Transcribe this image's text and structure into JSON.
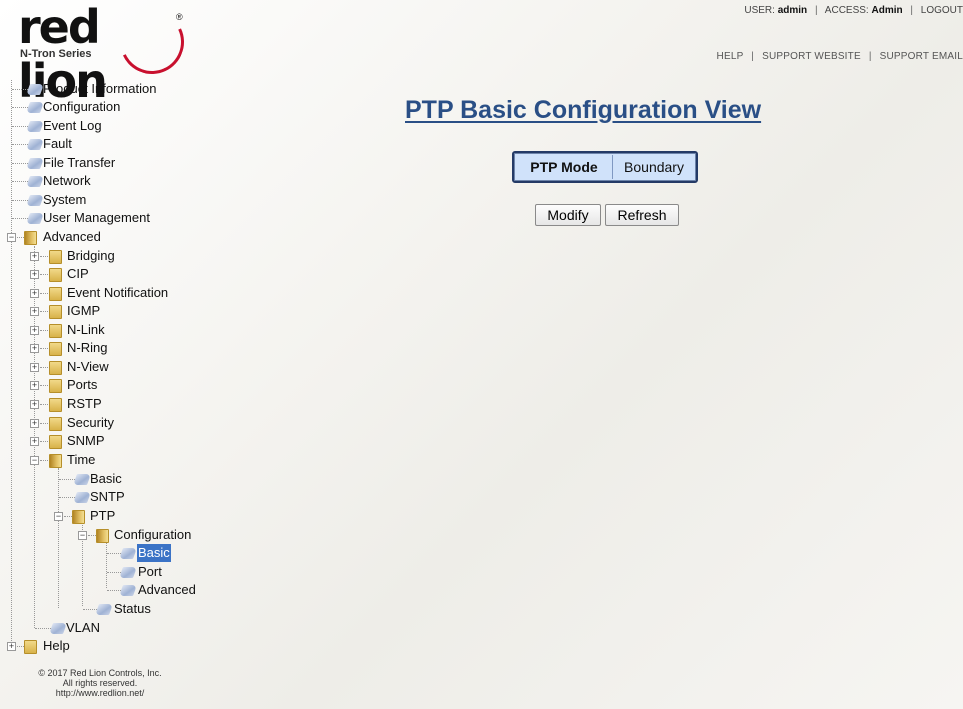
{
  "logo": {
    "word": "red lion",
    "sub": "N-Tron Series",
    "reg": "®"
  },
  "user_bar": {
    "user_label": "USER:",
    "user": "admin",
    "access_label": "ACCESS:",
    "access": "Admin",
    "logout": "LOGOUT"
  },
  "help_bar": {
    "help": "HELP",
    "support_website": "SUPPORT WEBSITE",
    "support_email": "SUPPORT EMAIL"
  },
  "tree": {
    "product_information": "Product Information",
    "configuration": "Configuration",
    "event_log": "Event Log",
    "fault": "Fault",
    "file_transfer": "File Transfer",
    "network": "Network",
    "system": "System",
    "user_management": "User Management",
    "advanced": "Advanced",
    "bridging": "Bridging",
    "cip": "CIP",
    "event_notification": "Event Notification",
    "igmp": "IGMP",
    "n_link": "N-Link",
    "n_ring": "N-Ring",
    "n_view": "N-View",
    "ports": "Ports",
    "rstp": "RSTP",
    "security": "Security",
    "snmp": "SNMP",
    "time": "Time",
    "time_basic": "Basic",
    "sntp": "SNTP",
    "ptp": "PTP",
    "ptp_configuration": "Configuration",
    "ptp_basic": "Basic",
    "ptp_port": "Port",
    "ptp_advanced": "Advanced",
    "ptp_status": "Status",
    "vlan": "VLAN",
    "help": "Help"
  },
  "copyright": {
    "line1": "© 2017 Red Lion Controls, Inc.",
    "line2": "All rights reserved.",
    "line3": "http://www.redlion.net/"
  },
  "main": {
    "title": "PTP Basic Configuration View",
    "mode_label": "PTP Mode",
    "mode_value": "Boundary",
    "modify": "Modify",
    "refresh": "Refresh"
  },
  "colors": {
    "title": "#2a4f86",
    "logo_accent": "#c8102e",
    "selected": "#3b73c6"
  }
}
